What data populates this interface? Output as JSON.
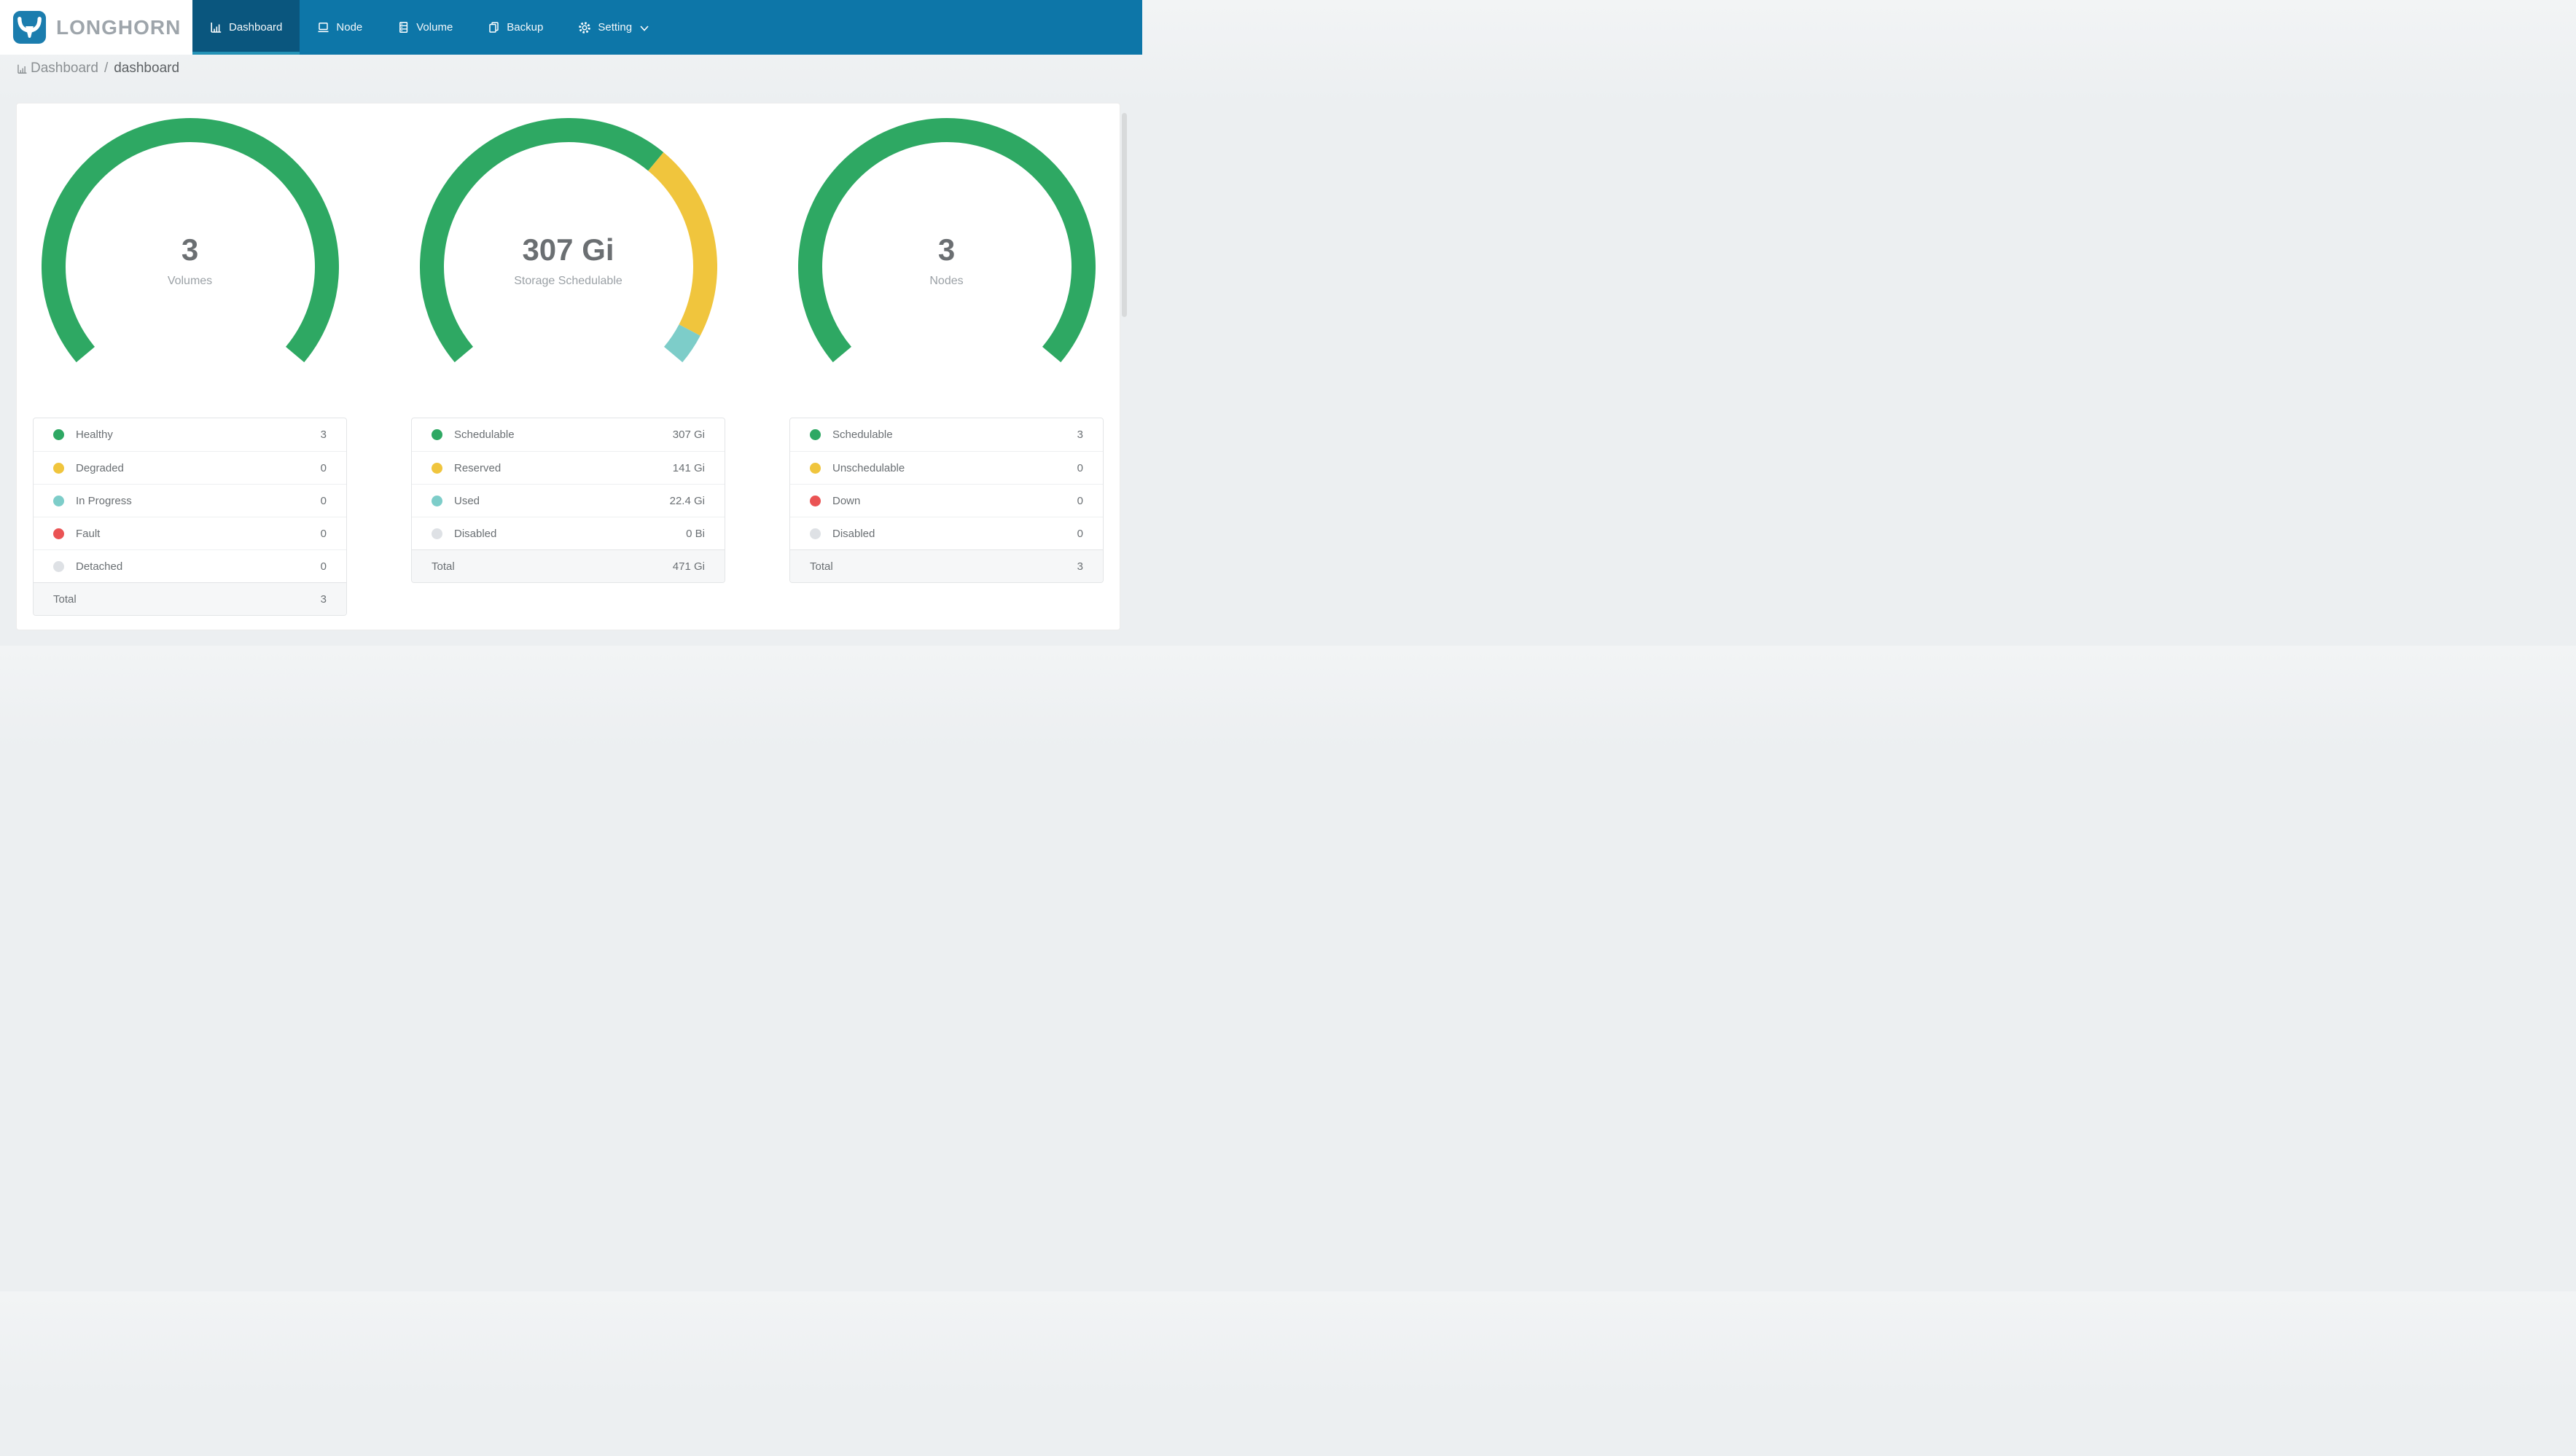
{
  "app": {
    "name": "LONGHORN"
  },
  "navbar": {
    "items": [
      {
        "id": "dashboard",
        "label": "Dashboard",
        "icon": "bar-chart-icon",
        "active": true
      },
      {
        "id": "node",
        "label": "Node",
        "icon": "laptop-icon",
        "active": false
      },
      {
        "id": "volume",
        "label": "Volume",
        "icon": "server-icon",
        "active": false
      },
      {
        "id": "backup",
        "label": "Backup",
        "icon": "copy-icon",
        "active": false
      },
      {
        "id": "setting",
        "label": "Setting",
        "icon": "gear-icon",
        "active": false,
        "has_dropdown": true
      }
    ]
  },
  "breadcrumb": {
    "section": "Dashboard",
    "separator": "/",
    "page": "dashboard"
  },
  "colors": {
    "navbar": "#0d76a8",
    "navbar_active": "#0a567e",
    "navbar_active_underline": "#2492b6",
    "green": "#2ea863",
    "yellow": "#f0c53d",
    "teal": "#7dcdc9",
    "red": "#ea5354",
    "gray": "#dee1e5"
  },
  "chart_data": [
    {
      "type": "donut",
      "title": "Volumes",
      "center_value": "3",
      "center_label": "Volumes",
      "start_angle": 140,
      "sweep": 260,
      "legend": [
        {
          "label": "Healthy",
          "value": "3",
          "numeric": 3,
          "color": "#2ea863"
        },
        {
          "label": "Degraded",
          "value": "0",
          "numeric": 0,
          "color": "#f0c53d"
        },
        {
          "label": "In Progress",
          "value": "0",
          "numeric": 0,
          "color": "#7dcdc9"
        },
        {
          "label": "Fault",
          "value": "0",
          "numeric": 0,
          "color": "#ea5354"
        },
        {
          "label": "Detached",
          "value": "0",
          "numeric": 0,
          "color": "#dee1e5"
        }
      ],
      "total": {
        "label": "Total",
        "value": "3"
      }
    },
    {
      "type": "donut",
      "title": "Storage Schedulable",
      "center_value": "307 Gi",
      "center_label": "Storage Schedulable",
      "start_angle": 140,
      "sweep": 260,
      "legend": [
        {
          "label": "Schedulable",
          "value": "307 Gi",
          "numeric": 307,
          "color": "#2ea863"
        },
        {
          "label": "Reserved",
          "value": "141 Gi",
          "numeric": 141,
          "color": "#f0c53d"
        },
        {
          "label": "Used",
          "value": "22.4 Gi",
          "numeric": 22.4,
          "color": "#7dcdc9"
        },
        {
          "label": "Disabled",
          "value": "0 Bi",
          "numeric": 0,
          "color": "#dee1e5"
        }
      ],
      "total": {
        "label": "Total",
        "value": "471 Gi"
      }
    },
    {
      "type": "donut",
      "title": "Nodes",
      "center_value": "3",
      "center_label": "Nodes",
      "start_angle": 140,
      "sweep": 260,
      "legend": [
        {
          "label": "Schedulable",
          "value": "3",
          "numeric": 3,
          "color": "#2ea863"
        },
        {
          "label": "Unschedulable",
          "value": "0",
          "numeric": 0,
          "color": "#f0c53d"
        },
        {
          "label": "Down",
          "value": "0",
          "numeric": 0,
          "color": "#ea5354"
        },
        {
          "label": "Disabled",
          "value": "0",
          "numeric": 0,
          "color": "#dee1e5"
        }
      ],
      "total": {
        "label": "Total",
        "value": "3"
      }
    }
  ]
}
